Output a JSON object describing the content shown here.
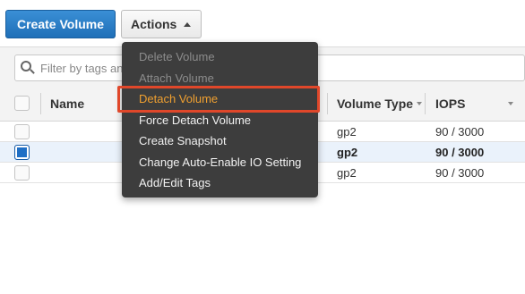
{
  "toolbar": {
    "create_label": "Create Volume",
    "actions_label": "Actions"
  },
  "filter": {
    "placeholder": "Filter by tags and attributes or search by keyword"
  },
  "table": {
    "columns": [
      "Name",
      "Volume Type",
      "IOPS"
    ],
    "rows": [
      {
        "volume_type": "gp2",
        "iops": "90 / 3000",
        "selected": false
      },
      {
        "volume_type": "gp2",
        "iops": "90 / 3000",
        "selected": true
      },
      {
        "volume_type": "gp2",
        "iops": "90 / 3000",
        "selected": false
      }
    ]
  },
  "menu": {
    "items": [
      {
        "label": "Delete Volume",
        "state": "disabled"
      },
      {
        "label": "Attach Volume",
        "state": "disabled"
      },
      {
        "label": "Detach Volume",
        "state": "highlighted"
      },
      {
        "label": "Force Detach Volume",
        "state": "enabled"
      },
      {
        "label": "Create Snapshot",
        "state": "enabled"
      },
      {
        "label": "Change Auto-Enable IO Setting",
        "state": "enabled"
      },
      {
        "label": "Add/Edit Tags",
        "state": "enabled"
      }
    ]
  },
  "colors": {
    "primary": "#1f6fb8",
    "menu_bg": "#3d3d3d",
    "highlight_text": "#f0a030",
    "annotation": "#e0472a",
    "selected_row": "#eaf2fb"
  }
}
